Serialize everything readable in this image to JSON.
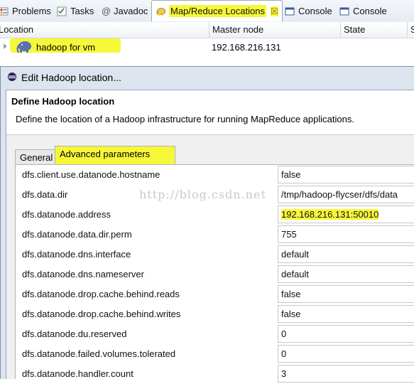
{
  "view_tabs": [
    {
      "label": "Problems",
      "icon": "problems-icon"
    },
    {
      "label": "Tasks",
      "icon": "tasks-icon"
    },
    {
      "label": "Javadoc",
      "icon": "at-icon"
    },
    {
      "label": "Map/Reduce Locations",
      "icon": "elephant-icon",
      "close": "☒"
    },
    {
      "label": "Console",
      "icon": "console-icon"
    },
    {
      "label": "Console",
      "icon": "console-icon"
    }
  ],
  "locations_table": {
    "columns": [
      "Location",
      "Master node",
      "State",
      "S"
    ],
    "rows": [
      {
        "location": "hadoop for vm",
        "master_node": "192.168.216.131",
        "state": ""
      }
    ]
  },
  "dialog": {
    "title": "Edit Hadoop location...",
    "heading": "Define Hadoop location",
    "description": "Define the location of a Hadoop infrastructure for running MapReduce applications.",
    "tabs": [
      "General",
      "Advanced parameters"
    ],
    "active_tab": "Advanced parameters",
    "parameters": [
      {
        "name": "dfs.client.use.datanode.hostname",
        "value": "false"
      },
      {
        "name": "dfs.data.dir",
        "value": "/tmp/hadoop-flycser/dfs/data"
      },
      {
        "name": "dfs.datanode.address",
        "value": "192.168.216.131:50010",
        "highlighted": true
      },
      {
        "name": "dfs.datanode.data.dir.perm",
        "value": "755"
      },
      {
        "name": "dfs.datanode.dns.interface",
        "value": "default"
      },
      {
        "name": "dfs.datanode.dns.nameserver",
        "value": "default"
      },
      {
        "name": "dfs.datanode.drop.cache.behind.reads",
        "value": "false"
      },
      {
        "name": "dfs.datanode.drop.cache.behind.writes",
        "value": "false"
      },
      {
        "name": "dfs.datanode.du.reserved",
        "value": "0"
      },
      {
        "name": "dfs.datanode.failed.volumes.tolerated",
        "value": "0"
      },
      {
        "name": "dfs.datanode.handler.count",
        "value": "3"
      }
    ]
  },
  "watermark": "http://blog.csdn.net",
  "colors": {
    "highlight": "#f7f73a",
    "accent": "#3c5a96"
  }
}
